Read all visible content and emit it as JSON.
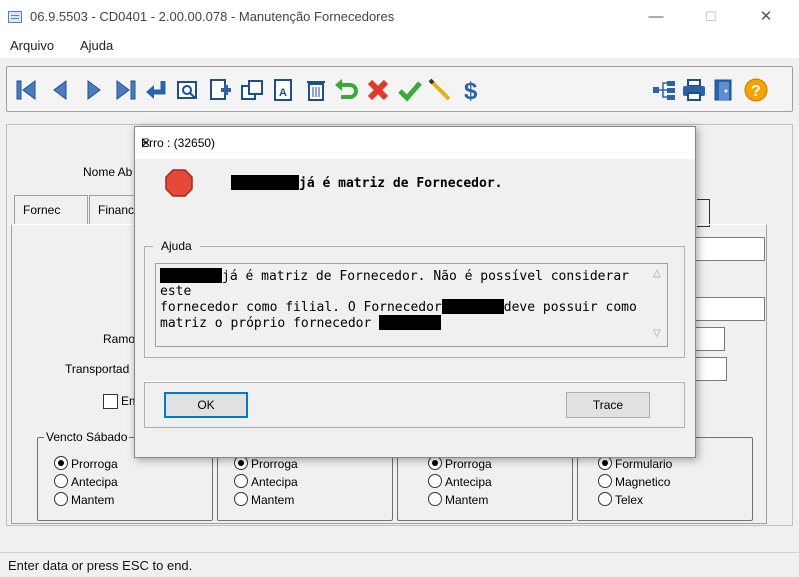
{
  "window": {
    "title": "06.9.5503 - CD0401 - 2.00.00.078 - Manutenção Fornecedores",
    "controls": {
      "minimize": "—",
      "maximize": "☐",
      "close": "✕"
    }
  },
  "menu": {
    "items": [
      "Arquivo",
      "Ajuda"
    ]
  },
  "toolbar": {
    "buttons": [
      "first-icon",
      "previous-icon",
      "next-icon",
      "last-icon",
      "goto-icon",
      "search-icon",
      "new-icon",
      "copy-icon",
      "edit-icon",
      "delete-icon",
      "undo-icon",
      "cancel-icon",
      "ok-icon",
      "pencil-icon",
      "dollar-icon",
      "tree-icon",
      "print-icon",
      "exit-icon",
      "help-icon"
    ],
    "dollar_label": "$",
    "help_label": "?"
  },
  "form": {
    "nome_abrev_label": "Nome Ab",
    "tabs": [
      "Fornec",
      "Financ"
    ],
    "ramo_label": "Ramo",
    "transportador_label": "Transportad",
    "checkbox_label": "Em",
    "groups": [
      {
        "title": "Vencto Sábado",
        "options": [
          "Prorroga",
          "Antecipa",
          "Mantem"
        ],
        "selected": "Prorroga"
      },
      {
        "title": "",
        "options": [
          "Prorroga",
          "Antecipa",
          "Mantem"
        ],
        "selected": "Prorroga"
      },
      {
        "title": "",
        "options": [
          "Prorroga",
          "Antecipa",
          "Mantem"
        ],
        "selected": "Prorroga"
      },
      {
        "title": "",
        "options": [
          "Formulario",
          "Magnetico",
          "Telex"
        ],
        "selected": "Formulario"
      }
    ]
  },
  "dialog": {
    "title": "Erro : (32650)",
    "close": "✕",
    "message": "já é matriz de Fornecedor.",
    "help_title": "Ajuda",
    "help_line1": "já é matriz de Fornecedor. Não é possível considerar este",
    "help_line2a": "fornecedor como filial. O Fornecedor",
    "help_line2b": "deve possuir como",
    "help_line3": "matriz o próprio fornecedor",
    "ok_label": "OK",
    "trace_label": "Trace"
  },
  "status": {
    "text": "Enter data or press ESC to end."
  }
}
